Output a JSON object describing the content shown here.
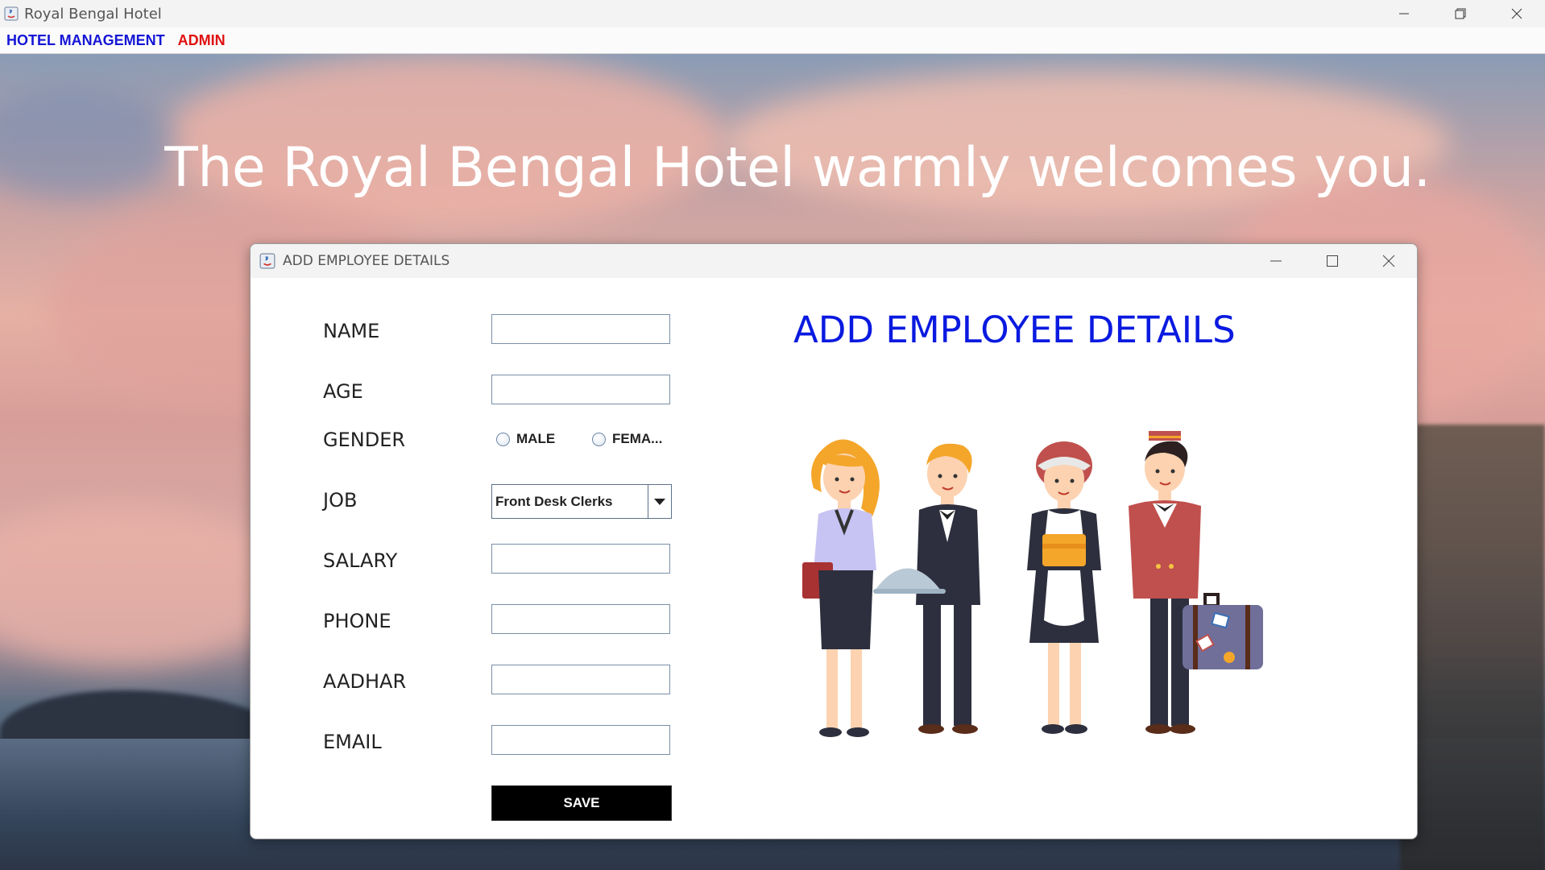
{
  "window": {
    "title": "Royal Bengal Hotel",
    "menu": [
      {
        "label": "HOTEL MANAGEMENT",
        "color": "#1515d6"
      },
      {
        "label": "ADMIN",
        "color": "#e01010"
      }
    ]
  },
  "background": {
    "welcome_text": "The Royal Bengal Hotel warmly welcomes you."
  },
  "dialog": {
    "title": "ADD EMPLOYEE DETAILS",
    "heading": "ADD EMPLOYEE DETAILS",
    "fields": {
      "name": {
        "label": "NAME",
        "value": ""
      },
      "age": {
        "label": "AGE",
        "value": ""
      },
      "gender": {
        "label": "GENDER",
        "options": [
          "MALE",
          "FEMA..."
        ],
        "selected": ""
      },
      "job": {
        "label": "JOB",
        "selected": "Front Desk Clerks"
      },
      "salary": {
        "label": "SALARY",
        "value": ""
      },
      "phone": {
        "label": "PHONE",
        "value": ""
      },
      "aadhar": {
        "label": "AADHAR",
        "value": ""
      },
      "email": {
        "label": "EMAIL",
        "value": ""
      }
    },
    "save_label": "SAVE",
    "illustration": "hotel-staff-illustration"
  },
  "colors": {
    "heading": "#0a1ae0",
    "save_button_bg": "#000000"
  }
}
